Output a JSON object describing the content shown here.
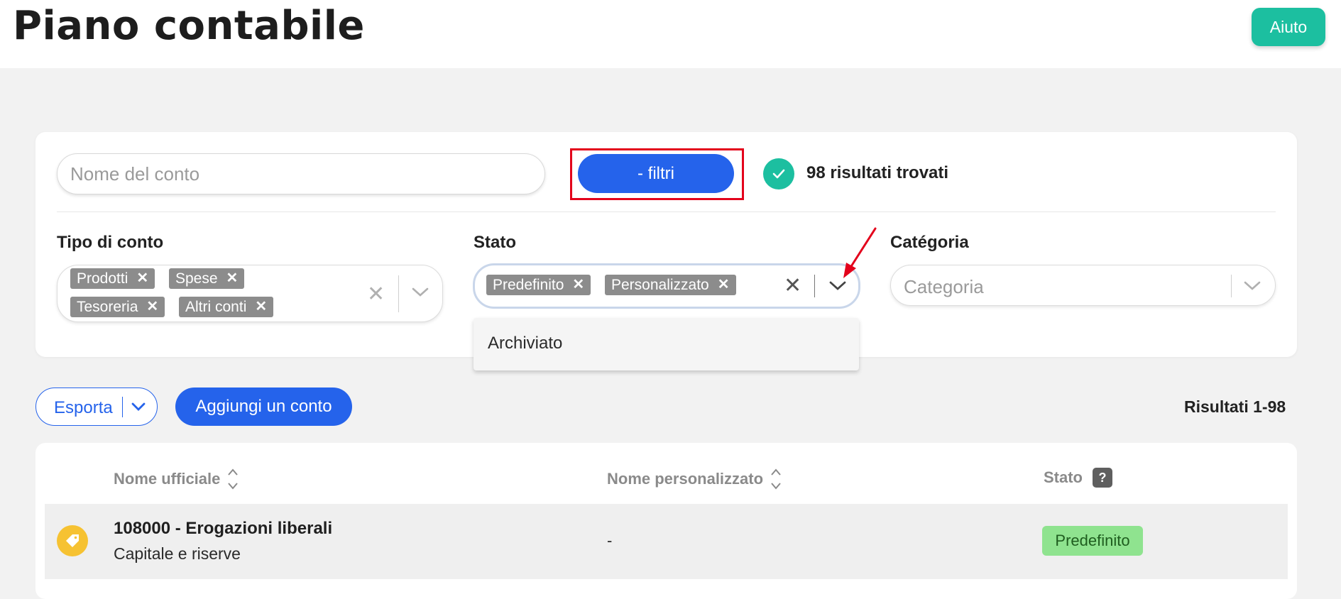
{
  "header": {
    "title": "Piano contabile",
    "help_label": "Aiuto"
  },
  "filters": {
    "search_placeholder": "Nome del conto",
    "toggle_label": "- filtri",
    "result_text": "98 risultati trovati",
    "tipo": {
      "label": "Tipo di conto",
      "tags": [
        "Prodotti",
        "Spese",
        "Tesoreria",
        "Altri conti"
      ]
    },
    "stato": {
      "label": "Stato",
      "tags": [
        "Predefinito",
        "Personalizzato"
      ],
      "dropdown_options": [
        "Archiviato"
      ]
    },
    "categoria": {
      "label": "Catégoria",
      "placeholder": "Categoria"
    },
    "remove_glyph": "✕"
  },
  "actions": {
    "export_label": "Esporta",
    "add_label": "Aggiungi un conto",
    "results_range": "Risultati 1-98"
  },
  "table": {
    "headers": {
      "official": "Nome ufficiale",
      "custom": "Nome personalizzato",
      "status": "Stato",
      "status_help": "?"
    },
    "rows": [
      {
        "title": "108000 - Erogazioni liberali",
        "subtitle": "Capitale e riserve",
        "custom_name": "-",
        "status": "Predefinito"
      }
    ]
  },
  "colors": {
    "primary": "#2563eb",
    "teal": "#1cbfa0",
    "tag_gray": "#8c8c8c",
    "status_green": "#8fe38f",
    "highlight_red": "#e3001b",
    "row_icon_yellow": "#f6c232"
  },
  "icons": {
    "check": "check-icon",
    "tag": "tag-icon",
    "sort": "sort-icon",
    "chevron": "chevron-down-icon",
    "clear": "close-icon",
    "annotation": "red-arrow"
  }
}
